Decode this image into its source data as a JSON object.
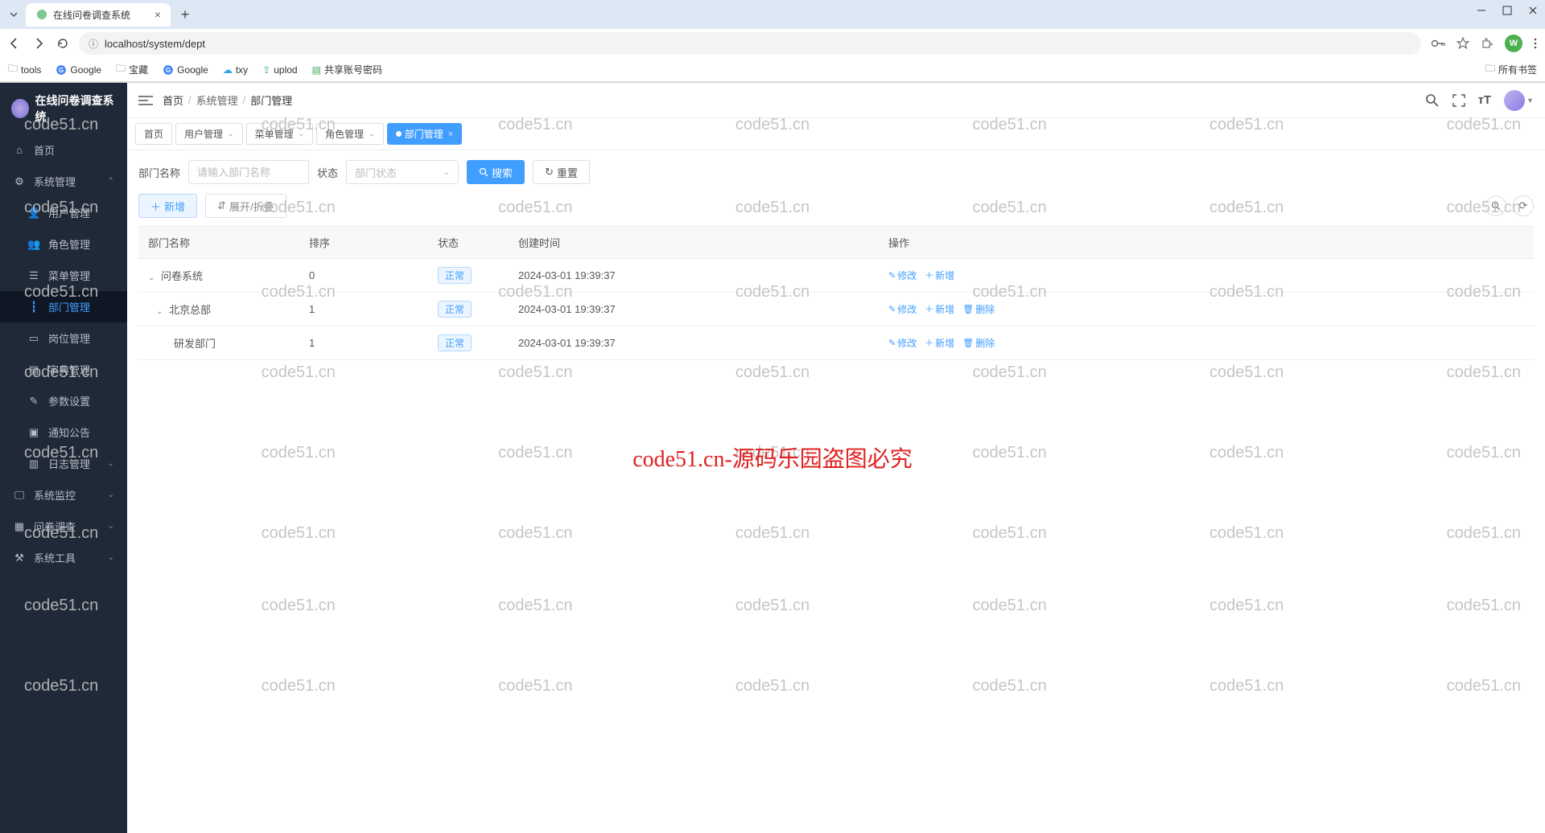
{
  "browser": {
    "tab_title": "在线问卷调查系统",
    "url": "localhost/system/dept",
    "bookmarks": [
      "tools",
      "Google",
      "宝藏",
      "Google",
      "txy",
      "uplod",
      "共享账号密码"
    ],
    "all_bookmarks": "所有书签",
    "avatar_letter": "W"
  },
  "brand": "在线问卷调查系统",
  "menu": {
    "home": "首页",
    "system": "系统管理",
    "user_mgmt": "用户管理",
    "role_mgmt": "角色管理",
    "menu_mgmt": "菜单管理",
    "dept_mgmt": "部门管理",
    "post_mgmt": "岗位管理",
    "dict_mgmt": "字典管理",
    "param_mgmt": "参数设置",
    "notice_mgmt": "通知公告",
    "log_mgmt": "日志管理",
    "monitor": "系统监控",
    "survey": "问卷调查",
    "tool": "系统工具"
  },
  "breadcrumb": {
    "home": "首页",
    "system": "系统管理",
    "current": "部门管理"
  },
  "tabs": {
    "home": "首页",
    "user": "用户管理",
    "menu": "菜单管理",
    "role": "角色管理",
    "dept": "部门管理"
  },
  "search": {
    "name_label": "部门名称",
    "name_placeholder": "请输入部门名称",
    "status_label": "状态",
    "status_placeholder": "部门状态",
    "search_btn": "搜索",
    "reset_btn": "重置"
  },
  "actions": {
    "add": "新增",
    "expand": "展开/折叠"
  },
  "table": {
    "cols": {
      "name": "部门名称",
      "sort": "排序",
      "status": "状态",
      "created": "创建时间",
      "ops": "操作"
    },
    "status_normal": "正常",
    "op_edit": "修改",
    "op_add": "新增",
    "op_delete": "删除",
    "rows": [
      {
        "name": "问卷系统",
        "sort": "0",
        "created": "2024-03-01 19:39:37",
        "level": 0,
        "has_delete": false
      },
      {
        "name": "北京总部",
        "sort": "1",
        "created": "2024-03-01 19:39:37",
        "level": 1,
        "has_delete": true
      },
      {
        "name": "研发部门",
        "sort": "1",
        "created": "2024-03-01 19:39:37",
        "level": 2,
        "has_delete": true
      }
    ]
  },
  "watermark": {
    "text": "code51.cn",
    "red_text": "code51.cn-源码乐园盗图必究"
  }
}
